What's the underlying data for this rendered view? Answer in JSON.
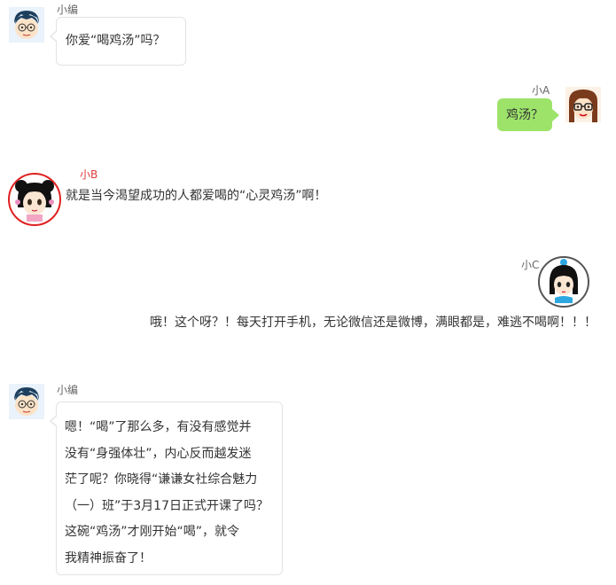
{
  "messages": [
    {
      "sender": "小编",
      "text": "你爱“喝鸡汤”吗？"
    },
    {
      "sender": "小A",
      "text": "鸡汤？"
    },
    {
      "sender": "小B",
      "text": "就是当今渴望成功的人都爱喝的“心灵鸡汤”啊！"
    },
    {
      "sender": "小C",
      "text": "哦！这个呀？！每天打开手机，无论微信还是微博，满眼都是，难逃不喝啊！！！"
    },
    {
      "sender": "小编",
      "text": "嗯！“喝”了那么多，有没有感觉并\n没有“身强体壮”，内心反而越发迷\n茫了呢？你晓得“谦谦女社综合魅力\n（一）班”于3月17日正式开课了吗？\n这碗“鸡汤”才刚开始“喝”，就令\n我精神振奋了！"
    }
  ],
  "colors": {
    "green_bubble": "#9de36a",
    "b_name": "#e03c3c",
    "ring_red": "#e02020"
  },
  "avatars": [
    "editor-avatar",
    "user-a-avatar",
    "user-b-avatar",
    "user-c-avatar",
    "editor-avatar"
  ]
}
